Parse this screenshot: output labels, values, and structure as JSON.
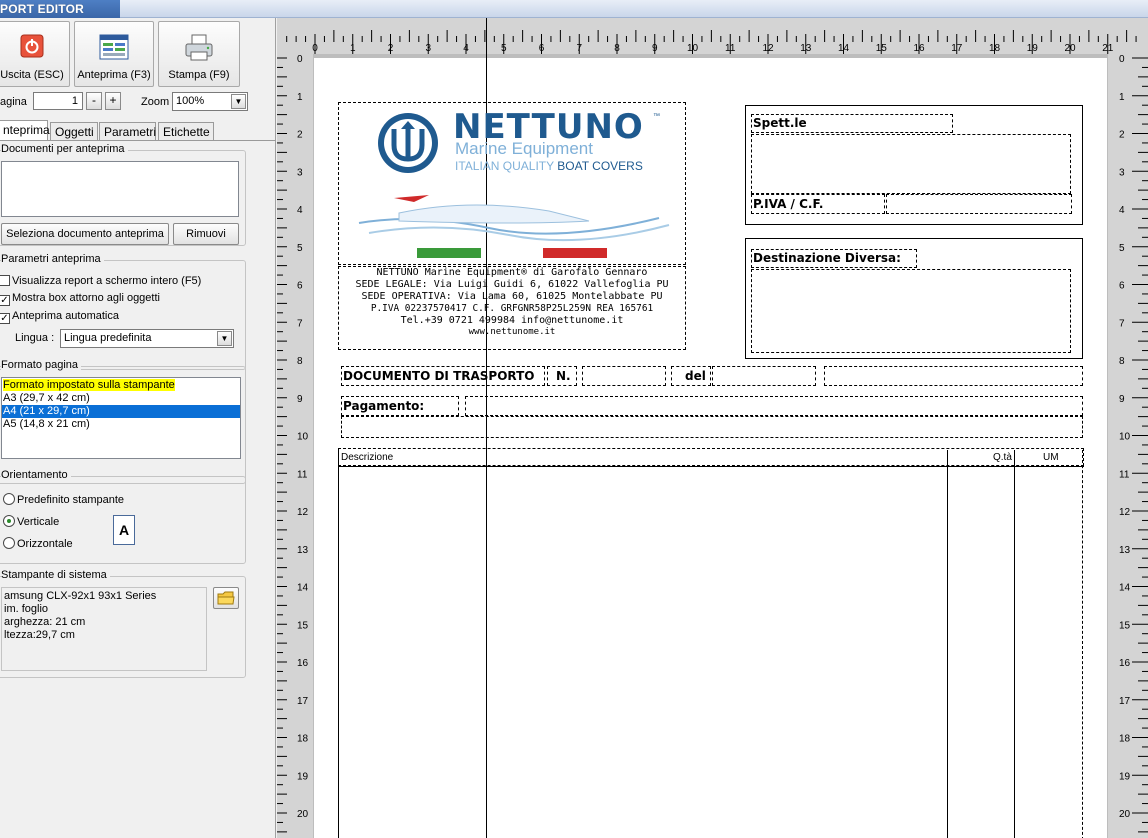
{
  "window": {
    "title": "PORT EDITOR"
  },
  "toolbar": {
    "exit_label": "Uscita (ESC)",
    "preview_label": "Anteprima (F3)",
    "print_label": "Stampa (F9)"
  },
  "page_nav": {
    "page_label": "agina",
    "page_value": "1",
    "minus": "-",
    "plus": "+",
    "zoom_label": "Zoom",
    "zoom_value": "100%"
  },
  "tabs": [
    "nteprima",
    "Oggetti",
    "Parametri",
    "Etichette"
  ],
  "documents": {
    "title": "Documenti per anteprima",
    "select_button": "Seleziona documento anteprima",
    "remove_button": "Rimuovi"
  },
  "preview_params": {
    "title": "Parametri anteprima",
    "fullscreen": "Visualizza report a schermo intero (F5)",
    "show_box": "Mostra box attorno agli oggetti",
    "auto_preview": "Anteprima automatica",
    "language_label": "Lingua :",
    "language_value": "Lingua predefinita"
  },
  "page_format": {
    "title": "Formato pagina",
    "items": [
      "Formato impostato sulla stampante",
      "A3 (29,7 x 42 cm)",
      "A4 (21 x 29,7 cm)",
      "A5 (14,8 x 21 cm)"
    ],
    "selected_index": 2
  },
  "orientation": {
    "title": "Orientamento",
    "options": [
      "Predefinito stampante",
      "Verticale",
      "Orizzontale"
    ],
    "selected_index": 1,
    "glyph": "A"
  },
  "printer": {
    "title": "Stampante di sistema",
    "lines": [
      "amsung CLX-92x1 93x1 Series",
      "im. foglio",
      "arghezza: 21 cm",
      "ltezza:29,7 cm"
    ],
    "folder_icon": "folder-icon"
  },
  "ruler": {
    "h_ticks": [
      "0",
      "1",
      "2",
      "3",
      "4",
      "5",
      "6",
      "7",
      "8",
      "9",
      "10",
      "11",
      "12",
      "13",
      "14",
      "15",
      "16",
      "17",
      "18",
      "19",
      "20",
      "21"
    ],
    "v_ticks": [
      "0",
      "1",
      "2",
      "3",
      "4",
      "5",
      "6",
      "7",
      "8",
      "9",
      "10",
      "11",
      "12",
      "13",
      "14",
      "15",
      "16",
      "17",
      "18",
      "19",
      "20"
    ]
  },
  "report": {
    "logo": {
      "brand": "NETTUNO",
      "sub": "Marine Equipment",
      "tagline_a": "ITALIAN QUALITY ",
      "tagline_b": "BOAT COVERS",
      "tm": "™"
    },
    "company_lines": [
      "NETTUNO Marine Equipment® di Garofalo Gennaro",
      "SEDE LEGALE: Via Luigi Guidi 6, 61022 Vallefoglia PU",
      "SEDE OPERATIVA: Via Lama 60, 61025 Montelabbate PU",
      "P.IVA 02237570417  C.F. GRFGNR58P25L259N  REA 165761",
      "Tel.+39 0721 499984  info@nettunome.it",
      "www.nettunome.it"
    ],
    "spett_label": "Spett.le",
    "piva_label": "P.IVA / C.F.",
    "dest_label": "Destinazione Diversa:",
    "ddt_label": "DOCUMENTO DI TRASPORTO",
    "num_label": "N.",
    "del_label": "del",
    "payment_label": "Pagamento:",
    "col_desc": "Descrizione",
    "col_qty": "Q.tà",
    "col_um": "UM"
  },
  "colors": {
    "brand_blue": "#1f5a8f",
    "light_blue": "#7fb0d8",
    "highlight_yellow": "#ffff00",
    "selection_blue": "#0a6fd6",
    "flag_green": "#3a9a3a",
    "flag_red": "#d02a2a"
  }
}
